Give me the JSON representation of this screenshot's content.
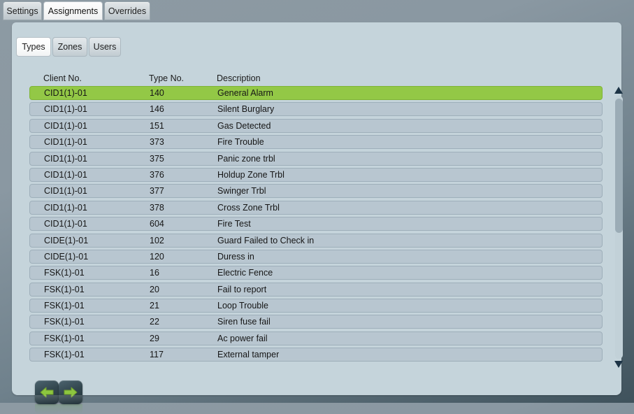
{
  "tabs": [
    {
      "label": "Settings",
      "active": false
    },
    {
      "label": "Assignments",
      "active": true
    },
    {
      "label": "Overrides",
      "active": false
    }
  ],
  "subtabs": [
    {
      "label": "Types",
      "active": true
    },
    {
      "label": "Zones",
      "active": false
    },
    {
      "label": "Users",
      "active": false
    }
  ],
  "table": {
    "headers": {
      "client": "Client No.",
      "type": "Type No.",
      "description": "Description"
    },
    "rows": [
      {
        "client": "CID1(1)-01",
        "type": "140",
        "description": "General Alarm",
        "selected": true
      },
      {
        "client": "CID1(1)-01",
        "type": "146",
        "description": "Silent Burglary",
        "selected": false
      },
      {
        "client": "CID1(1)-01",
        "type": "151",
        "description": "Gas Detected",
        "selected": false
      },
      {
        "client": "CID1(1)-01",
        "type": "373",
        "description": "Fire Trouble",
        "selected": false
      },
      {
        "client": "CID1(1)-01",
        "type": "375",
        "description": "Panic zone trbl",
        "selected": false
      },
      {
        "client": "CID1(1)-01",
        "type": "376",
        "description": "Holdup Zone Trbl",
        "selected": false
      },
      {
        "client": "CID1(1)-01",
        "type": "377",
        "description": "Swinger Trbl",
        "selected": false
      },
      {
        "client": "CID1(1)-01",
        "type": "378",
        "description": "Cross Zone Trbl",
        "selected": false
      },
      {
        "client": "CID1(1)-01",
        "type": "604",
        "description": "Fire Test",
        "selected": false
      },
      {
        "client": "CIDE(1)-01",
        "type": "102",
        "description": "Guard Failed to Check in",
        "selected": false
      },
      {
        "client": "CIDE(1)-01",
        "type": "120",
        "description": "Duress in",
        "selected": false
      },
      {
        "client": "FSK(1)-01",
        "type": "16",
        "description": "Electric Fence",
        "selected": false
      },
      {
        "client": "FSK(1)-01",
        "type": "20",
        "description": "Fail to report",
        "selected": false
      },
      {
        "client": "FSK(1)-01",
        "type": "21",
        "description": "Loop Trouble",
        "selected": false
      },
      {
        "client": "FSK(1)-01",
        "type": "22",
        "description": "Siren fuse fail",
        "selected": false
      },
      {
        "client": "FSK(1)-01",
        "type": "29",
        "description": "Ac power fail",
        "selected": false
      },
      {
        "client": "FSK(1)-01",
        "type": "117",
        "description": "External tamper",
        "selected": false
      }
    ]
  },
  "scrollbar": {
    "up_icon": "triangle-up-icon",
    "down_icon": "triangle-down-icon"
  },
  "nav": {
    "prev_icon": "arrow-left-icon",
    "next_icon": "arrow-right-icon"
  },
  "colors": {
    "selected_row": "#93c846",
    "row": "#b8c6d0",
    "panel": "#c5d4db",
    "arrow_green": "#8dc63f"
  }
}
